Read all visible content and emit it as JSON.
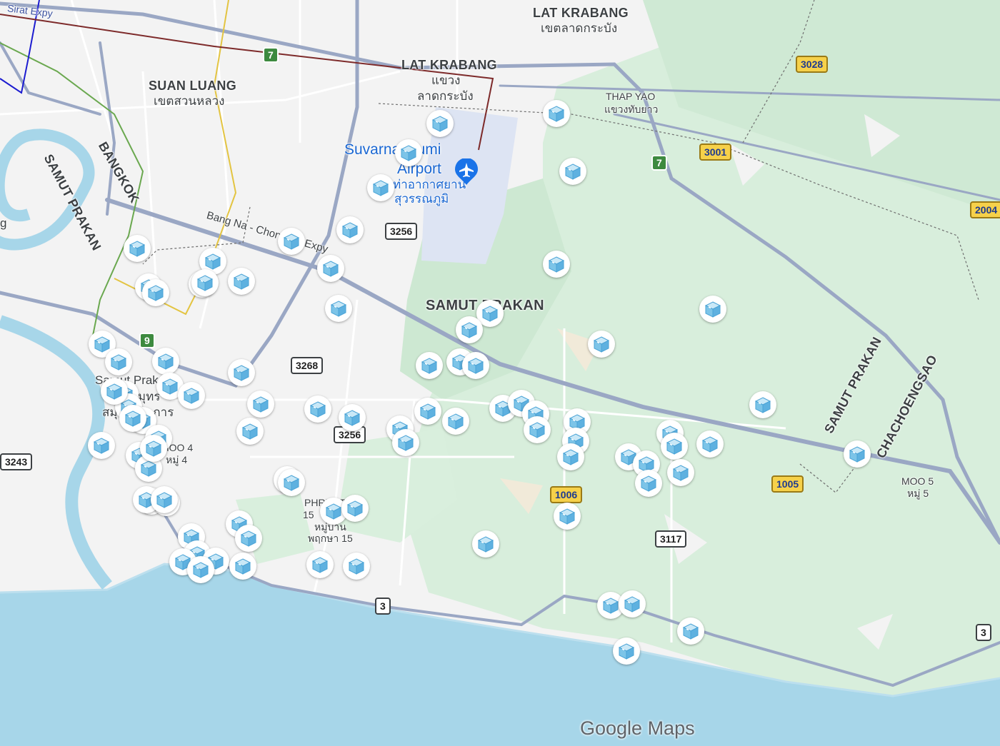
{
  "map": {
    "attribution": "Google Maps",
    "colors": {
      "water": "#a7d6e9",
      "land": "#f3f3f3",
      "park": "#d5ecd8",
      "road": "#9aa7c4",
      "rail": "#7d2a2a",
      "pin_icon": "#7cc4e8"
    }
  },
  "labels": [
    {
      "id": "sirat-expy",
      "text": "Sirat Expy"
    },
    {
      "id": "lat-krabang-district",
      "text": "LAT KRABANG"
    },
    {
      "id": "lat-krabang-district-th",
      "text": "เขตลาดกระบัง"
    },
    {
      "id": "lat-krabang-sub",
      "text": "LAT KRABANG"
    },
    {
      "id": "lat-krabang-sub-th1",
      "text": "แขวง"
    },
    {
      "id": "lat-krabang-sub-th2",
      "text": "ลาดกระบัง"
    },
    {
      "id": "thap-yao",
      "text": "THAP YAO"
    },
    {
      "id": "thap-yao-th",
      "text": "แขวงทับยาว"
    },
    {
      "id": "suan-luang",
      "text": "SUAN LUANG"
    },
    {
      "id": "suan-luang-th",
      "text": "เขตสวนหลวง"
    },
    {
      "id": "suvarnabhumi",
      "text": "Suvarnabhumi"
    },
    {
      "id": "airport",
      "text": "Airport"
    },
    {
      "id": "airport-th1",
      "text": "ท่าอากาศยาน"
    },
    {
      "id": "airport-th2",
      "text": "สุวรรณภูมิ"
    },
    {
      "id": "bangkok",
      "text": "BANGKOK"
    },
    {
      "id": "samut-prakan-left",
      "text": "SAMUT PRAKAN"
    },
    {
      "id": "bang-na-expy",
      "text": "Bang Na - Chon Buri Expy"
    },
    {
      "id": "samut-prakan-center",
      "text": "SAMUT PRAKAN"
    },
    {
      "id": "samut-prakan-city",
      "text": "Samut Prakan"
    },
    {
      "id": "samut-prakan-city-th1",
      "text": "เมืองสมุทร"
    },
    {
      "id": "samut-prakan-city-th2",
      "text": "สมุทรปราการ"
    },
    {
      "id": "moo4",
      "text": "MOO 4"
    },
    {
      "id": "moo4-th",
      "text": "หมู่ 4"
    },
    {
      "id": "phru-15",
      "text": "PHRUETSA"
    },
    {
      "id": "phru-15-num",
      "text": "15"
    },
    {
      "id": "phru-15-th1",
      "text": "หมู่บ้าน"
    },
    {
      "id": "phru-15-th2",
      "text": "พฤกษา 15"
    },
    {
      "id": "samut-prakan-right",
      "text": "SAMUT PRAKAN"
    },
    {
      "id": "chachoengsao",
      "text": "CHACHOENGSAO"
    },
    {
      "id": "moo5",
      "text": "MOO 5"
    },
    {
      "id": "moo5-th",
      "text": "หมู่ 5"
    },
    {
      "id": "g-partial",
      "text": "g"
    }
  ],
  "shields": [
    {
      "id": "shield-7-top",
      "text": "7"
    },
    {
      "id": "shield-7-right",
      "text": "7"
    },
    {
      "id": "shield-9",
      "text": "9"
    },
    {
      "id": "shield-3028",
      "text": "3028"
    },
    {
      "id": "shield-3001",
      "text": "3001"
    },
    {
      "id": "shield-2004",
      "text": "2004"
    },
    {
      "id": "shield-3256-top",
      "text": "3256"
    },
    {
      "id": "shield-3268",
      "text": "3268"
    },
    {
      "id": "shield-3256-mid",
      "text": "3256"
    },
    {
      "id": "shield-3243",
      "text": "3243"
    },
    {
      "id": "shield-1006",
      "text": "1006"
    },
    {
      "id": "shield-1005",
      "text": "1005"
    },
    {
      "id": "shield-3117",
      "text": "3117"
    },
    {
      "id": "shield-3-left",
      "text": "3"
    },
    {
      "id": "shield-3-right",
      "text": "3"
    }
  ],
  "pins": {
    "icon": "ice-cube-icon",
    "count": 88
  }
}
